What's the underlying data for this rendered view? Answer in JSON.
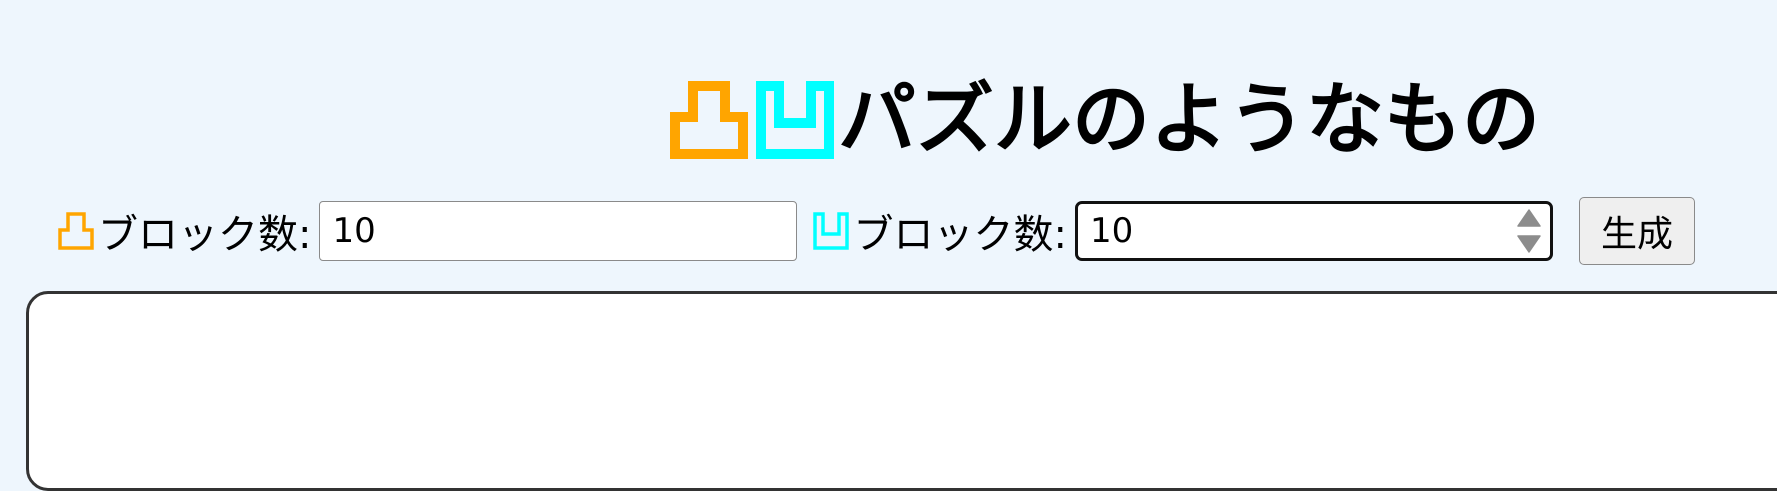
{
  "header": {
    "title": "パズルのようなもの",
    "convex_icon": "convex-block-icon",
    "concave_icon": "concave-block-icon"
  },
  "controls": {
    "convex_label": "ブロック数:",
    "convex_value": "10",
    "concave_label": "ブロック数:",
    "concave_value": "10",
    "generate_label": "生成"
  },
  "colors": {
    "background": "#eef6fd",
    "convex": "#ffa500",
    "concave": "#00ffff",
    "board_border": "#333333"
  },
  "icons": {
    "spin_up": "triangle-up-icon",
    "spin_down": "triangle-down-icon"
  }
}
